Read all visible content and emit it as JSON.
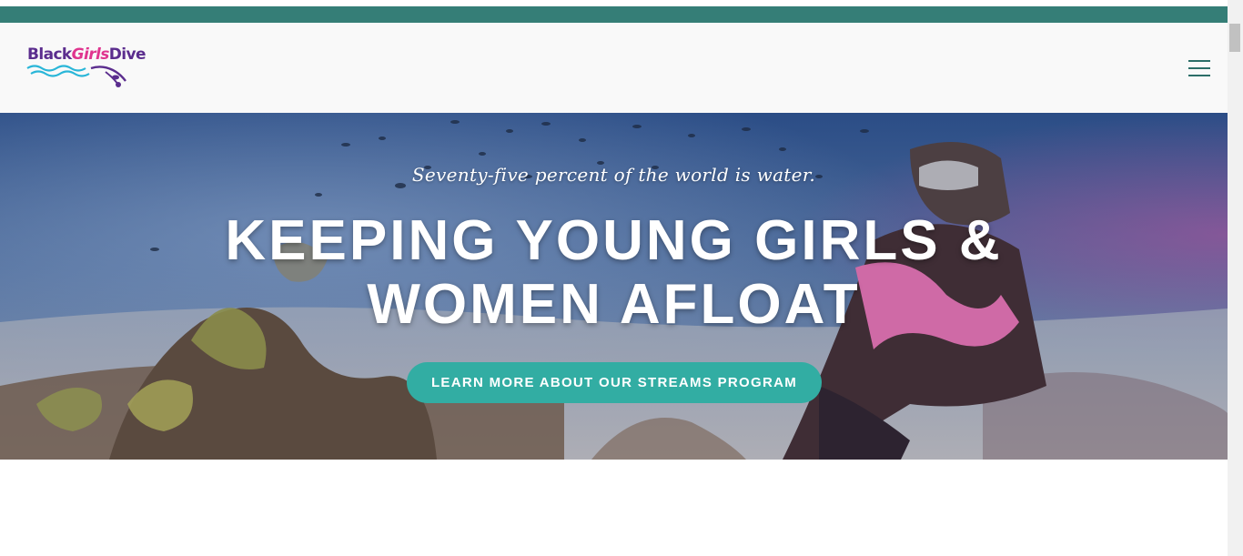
{
  "colors": {
    "teal_bar": "#357e77",
    "header_bg": "#f9f9f9",
    "logo_purple": "#5b2d8e",
    "logo_pink": "#e0358f",
    "logo_wave": "#29b6d8",
    "cta_bg": "#32ada3",
    "hamburger": "#2c6e68"
  },
  "header": {
    "logo": {
      "part1": "Black",
      "part2": "Girls",
      "part3": "Dive",
      "alt": "BlackGirlsDive"
    },
    "menu_icon": "hamburger-menu-icon"
  },
  "hero": {
    "tagline": "Seventy-five percent of the world is water.",
    "title_line1": "KEEPING YOUNG GIRLS &",
    "title_line2": "WOMEN AFLOAT",
    "cta_label": "LEARN MORE ABOUT OUR STREAMS PROGRAM",
    "background": "underwater scuba diver with coral reef"
  }
}
